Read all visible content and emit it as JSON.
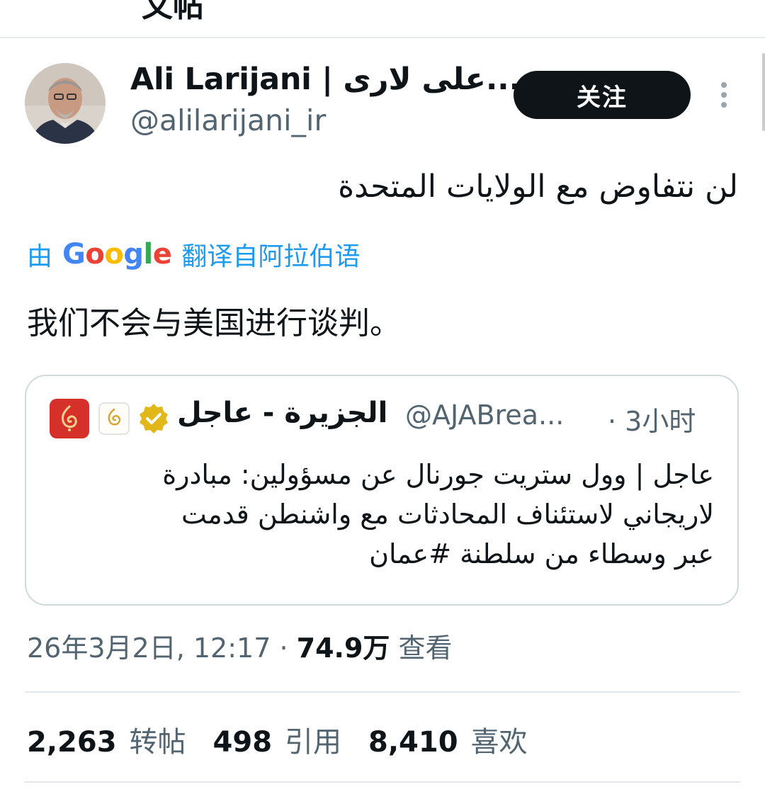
{
  "header": {
    "title_fragment": "文帖"
  },
  "author": {
    "display_name": "Ali Larijani | على لارى...",
    "handle": "@alilarijani_ir",
    "follow_label": "关注"
  },
  "tweet": {
    "original_text": "لن نتفاوض مع الولايات المتحدة",
    "translation": {
      "by": "由",
      "engine_letters": [
        "G",
        "o",
        "o",
        "g",
        "l",
        "e"
      ],
      "engine_colors": [
        "#4285F4",
        "#EA4335",
        "#FBBC05",
        "#4285F4",
        "#34A853",
        "#EA4335"
      ],
      "from": "翻译自阿拉伯语"
    },
    "translated_text": "我们不会与美国进行谈判。"
  },
  "quote": {
    "name": "الجزيرة - عاجل",
    "handle": "@AJABrea...",
    "time": "· 3小时",
    "verified_color": "#e2b719",
    "lines": [
      "عاجل | وول ستريت جورنال عن مسؤولين: مبادرة",
      "لاريجاني لاستئناف المحادثات مع واشنطن قدمت",
      "عبر وسطاء من سلطنة #عمان"
    ]
  },
  "meta": {
    "datetime": "26年3月2日, 12:17",
    "separator": " · ",
    "views_count": "74.9万",
    "views_label": " 查看"
  },
  "stats": [
    {
      "count": "2,263",
      "label": "转帖"
    },
    {
      "count": "498",
      "label": "引用"
    },
    {
      "count": "8,410",
      "label": "喜欢"
    }
  ]
}
